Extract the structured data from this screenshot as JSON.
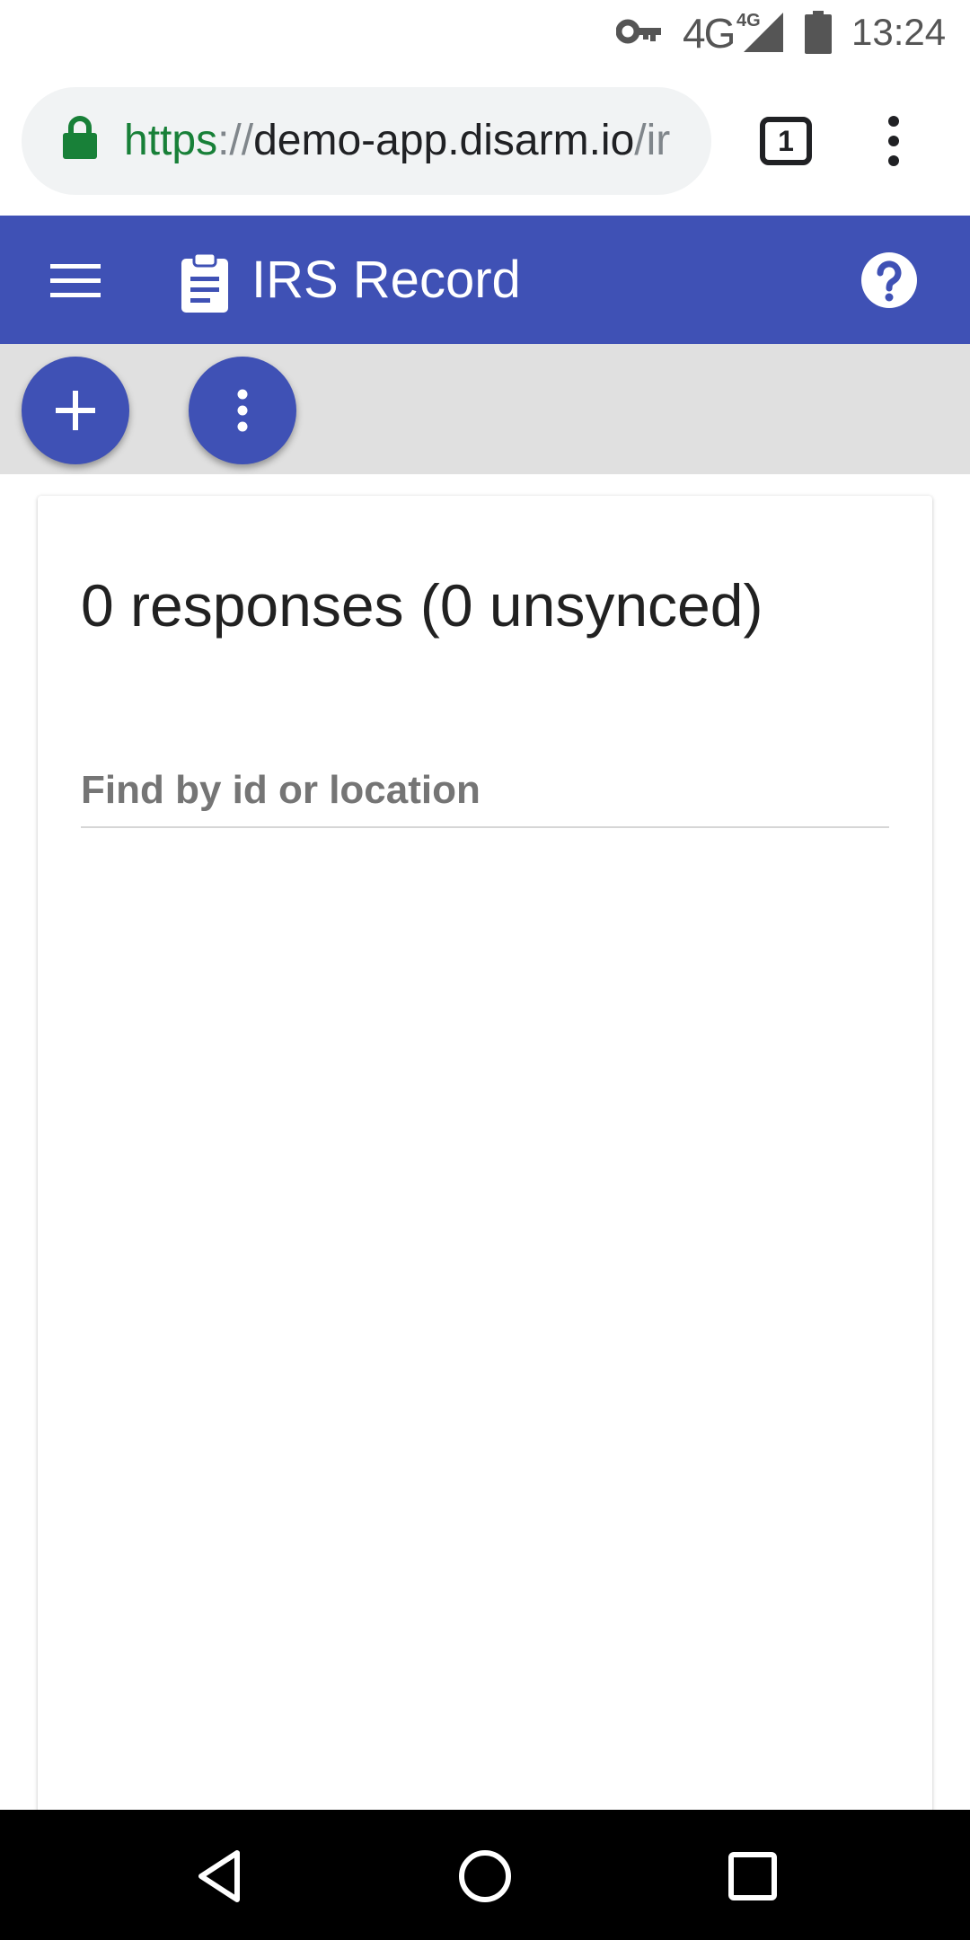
{
  "status_bar": {
    "network": "4G",
    "network_sup": "4G",
    "time": "13:24"
  },
  "browser": {
    "url_scheme": "https",
    "url_separator": "://",
    "url_host": "demo-app.disarm.io",
    "url_rest": "/ir",
    "tab_count": "1"
  },
  "app_bar": {
    "title": "IRS Record"
  },
  "card": {
    "summary": "0 responses (0 unsynced)",
    "search_placeholder": "Find by id or location"
  },
  "colors": {
    "primary": "#3f51b5",
    "toolbar_bg": "#e0e0e0",
    "secure_green": "#188038"
  }
}
